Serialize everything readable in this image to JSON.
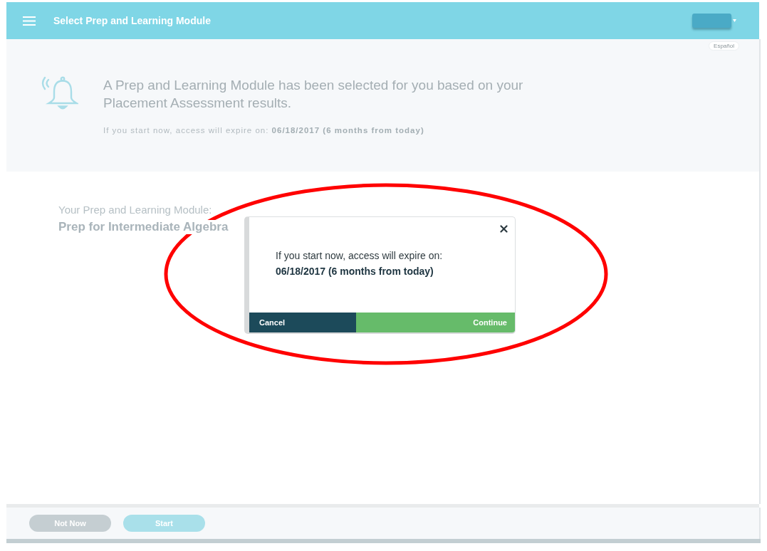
{
  "header": {
    "title": "Select Prep and Learning Module"
  },
  "language_link": {
    "label": "Español"
  },
  "banner": {
    "headline": "A Prep and Learning Module has been selected for you based on your Placement Assessment results.",
    "note": "If you start now, access will expire on: **06/18/2017 (6 months from today)**"
  },
  "module": {
    "label": "Your Prep and Learning Module:",
    "name": "Prep for Intermediate Algebra"
  },
  "dialog": {
    "message": "If you start now, access will expire on:",
    "date": "06/18/2017 (6 months from today)",
    "buttons": [
      {
        "label": "Cancel",
        "kind": "secondary"
      },
      {
        "label": "Continue",
        "kind": "primary"
      }
    ]
  },
  "footer": {
    "buttons": [
      {
        "label": "Not Now",
        "kind": "secondary"
      },
      {
        "label": "Start",
        "kind": "primary"
      }
    ]
  },
  "annotations": [
    {
      "kind": "ellipse"
    }
  ]
}
